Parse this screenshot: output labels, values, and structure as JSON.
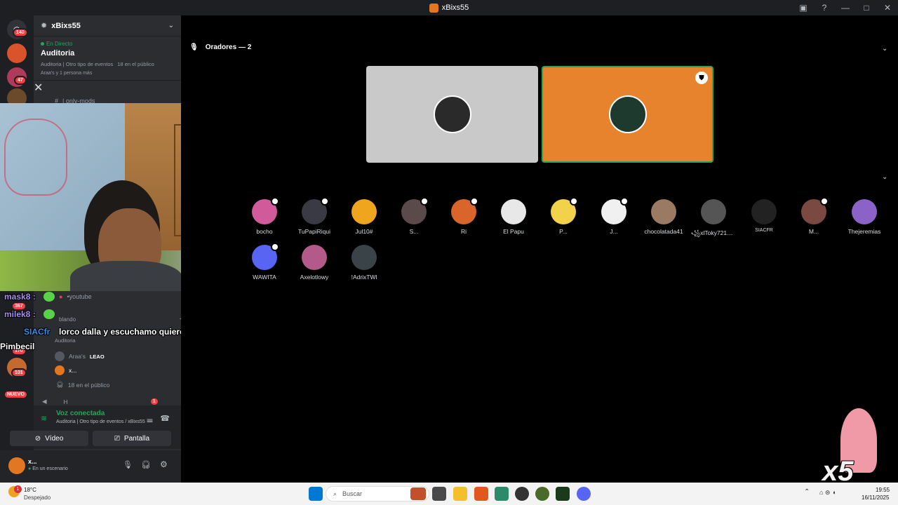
{
  "window": {
    "title": "xBixs55"
  },
  "server_badges": [
    "140",
    "47",
    "367",
    "170",
    "101"
  ],
  "new_label": "NUEVO",
  "sidebar": {
    "server_name": "xBixs55",
    "live": {
      "tag": "En Directo",
      "title": "Auditoria",
      "meta_left": "Auditoria | Otro tipo de eventos",
      "meta_right": "18 en el público",
      "who": "Araa's y 1 persona más"
    },
    "channels": {
      "only_mods": "| only-mods",
      "youtube": "•youtube",
      "hablando": "blando",
      "stage_sub": "Auditoria",
      "araas": "Araa's",
      "leao": "LEAO",
      "xdots": "x...",
      "publico": "18 en el público",
      "h": "H"
    },
    "h_badge": "1"
  },
  "overlay": {
    "chat_line1_user": "mask8",
    "chat_line2_user": "milek8",
    "siac": "SIACfr",
    "msg": "lorco dalla y escuchamo quiero escucharte",
    "insult": "Pimbecil"
  },
  "voice": {
    "status": "Voz conectada",
    "sub": "Auditoria | Otro tipo de eventos / xBixs55",
    "video": "Vídeo",
    "screen": "Pantalla"
  },
  "user": {
    "name": "x...",
    "status": "En un escenario"
  },
  "stage": {
    "speakers_header": "Oradores — 2",
    "audience": [
      "bocho",
      "TuPapiRiqui",
      "Jul10#",
      "S...",
      "Ri",
      "El Papu",
      "P...",
      "J...",
      "chocolatada41",
      "꧁xlToky7214꧂...",
      "SIACFR",
      "M...",
      "Thejeremias",
      "WAWITA",
      "Axelotlowy",
      "!AdrixTWl"
    ]
  },
  "sticker": {
    "label": "x5"
  },
  "taskbar": {
    "weather_temp": "18°C",
    "weather_desc": "Despejado",
    "weather_badge": "1",
    "search": "Buscar",
    "time": "19:55",
    "date": "16/11/2025"
  }
}
